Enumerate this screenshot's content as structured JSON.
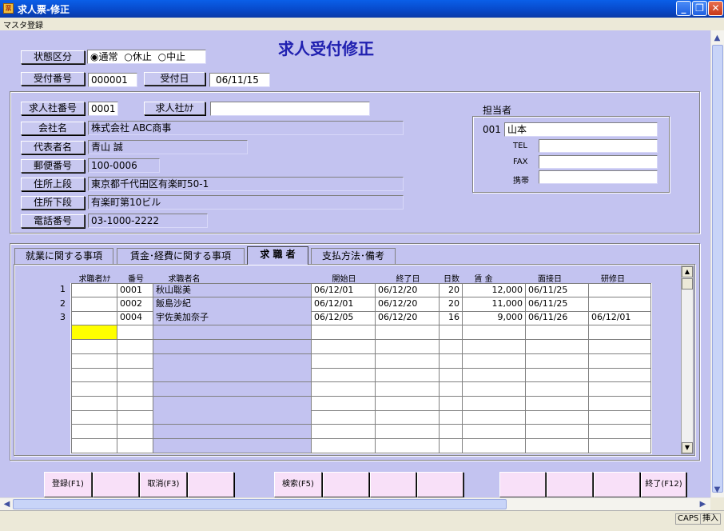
{
  "window": {
    "title": "求人票-修正",
    "menu": "マスタ登録"
  },
  "heading": "求人受付修正",
  "status": {
    "label": "状態区分",
    "options": [
      "通常",
      "休止",
      "中止"
    ],
    "selected": 0
  },
  "uketsuke": {
    "no_label": "受付番号",
    "no": "000001",
    "date_label": "受付日",
    "date": "06/11/15"
  },
  "company": {
    "no_label": "求人社番号",
    "no": "0001",
    "kana_label": "求人社ｶﾅ",
    "kana": "",
    "name_label": "会社名",
    "name": "株式会社 ABC商事",
    "rep_label": "代表者名",
    "rep": "青山 誠",
    "zip_label": "郵便番号",
    "zip": "100-0006",
    "addr1_label": "住所上段",
    "addr1": "東京都千代田区有楽町50-1",
    "addr2_label": "住所下段",
    "addr2": "有楽町第10ビル",
    "tel_label": "電話番号",
    "tel": "03-1000-2222"
  },
  "tanto": {
    "label": "担当者",
    "code": "001",
    "name": "山本",
    "tel_label": "TEL",
    "fax_label": "FAX",
    "mobile_label": "携帯"
  },
  "tabs": [
    "就業に関する事項",
    "賃金･経費に関する事項",
    "求 職 者",
    "支払方法･備考"
  ],
  "grid": {
    "headers": [
      "求職者ｶﾅ",
      "番号",
      "求職者名",
      "開始日",
      "終了日",
      "日数",
      "賃 金",
      "面接日",
      "研修日"
    ],
    "rows": [
      {
        "n": "1",
        "kana": "",
        "no": "0001",
        "name": "秋山聡美",
        "start": "06/12/01",
        "end": "06/12/20",
        "days": "20",
        "wage": "12,000",
        "interview": "06/11/25",
        "training": ""
      },
      {
        "n": "2",
        "kana": "",
        "no": "0002",
        "name": "飯島沙紀",
        "start": "06/12/01",
        "end": "06/12/20",
        "days": "20",
        "wage": "11,000",
        "interview": "06/11/25",
        "training": ""
      },
      {
        "n": "3",
        "kana": "",
        "no": "0004",
        "name": "宇佐美加奈子",
        "start": "06/12/05",
        "end": "06/12/20",
        "days": "16",
        "wage": "9,000",
        "interview": "06/11/26",
        "training": "06/12/01"
      }
    ]
  },
  "fkeys": {
    "register": "登録(F1)",
    "cancel": "取消(F3)",
    "search": "検索(F5)",
    "exit": "終了(F12)"
  },
  "statusbar": {
    "caps": "CAPS",
    "ins": "挿入"
  },
  "colors": {
    "form_bg": "#c3c3f0",
    "titlebar": "#0848c8",
    "fkey_bg": "#f8e0f8",
    "focus_cell": "#ffff00"
  }
}
